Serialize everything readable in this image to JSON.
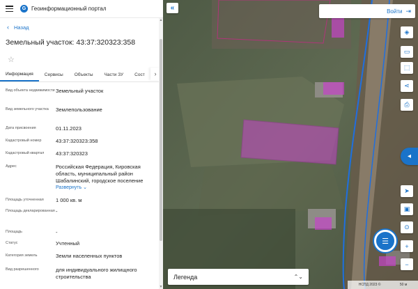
{
  "header": {
    "portal_title": "Геоинформационный портал",
    "logo_letter": "G"
  },
  "nav": {
    "back_label": "Назад"
  },
  "page": {
    "title": "Земельный участок: 43:37:320323:358"
  },
  "tabs": [
    {
      "label": "Информация",
      "active": true
    },
    {
      "label": "Сервисы"
    },
    {
      "label": "Объекты"
    },
    {
      "label": "Части ЗУ"
    },
    {
      "label": "Сост"
    }
  ],
  "properties": {
    "object_kind_label": "Вид объекта недвижимости",
    "object_kind_value": "Земельный участок",
    "parcel_kind_label": "Вид земельного участка",
    "parcel_kind_value": "Землепользование",
    "assign_date_label": "Дата присвоения",
    "assign_date_value": "01.11.2023",
    "cad_number_label": "Кадастровый номер",
    "cad_number_value": "43:37:320323:358",
    "cad_quarter_label": "Кадастровый квартал",
    "cad_quarter_value": "43:37:320323",
    "address_label": "Адрес",
    "address_value": "Российская Федерация, Кировская область, муниципальный район Шабалинский, городское поселение",
    "expand_label": "Развернуть",
    "area_specified_label": "Площадь уточненная",
    "area_specified_value": "1 000 кв. м",
    "area_declared_label": "Площадь декларированная",
    "area_declared_value": "-",
    "area_label": "Площадь",
    "area_value": "-",
    "status_label": "Статус",
    "status_value": "Учтенный",
    "category_label": "Категория земель",
    "category_value": "Земли населенных пунктов",
    "permitted_use_label": "Вид разрешенного",
    "permitted_use_value": "для индивидуального жилищного строительства"
  },
  "map": {
    "login_label": "Войти",
    "legend_label": "Легенда",
    "attribution": "НСПД 2023 ©",
    "scale_label": "50 м"
  },
  "colors": {
    "accent": "#1a73c9",
    "parcel_fill": "#c445c8",
    "road_line": "#1f6fe0"
  },
  "icons": {
    "burger": "menu-icon",
    "back": "chevron-left-icon",
    "favorite": "star-icon",
    "collapse": "double-chevron-left-icon",
    "login": "login-icon",
    "layers": "layers-icon",
    "basemap": "basemap-icon",
    "select": "select-area-icon",
    "share": "share-icon",
    "print": "print-icon",
    "panel": "side-panel-icon",
    "locate": "navigation-icon",
    "screen": "screen-icon",
    "search_place": "place-search-icon",
    "zoom_in": "plus-icon",
    "zoom_out": "minus-icon",
    "chat": "chat-icon",
    "legend_toggle": "chevron-updown-icon"
  }
}
